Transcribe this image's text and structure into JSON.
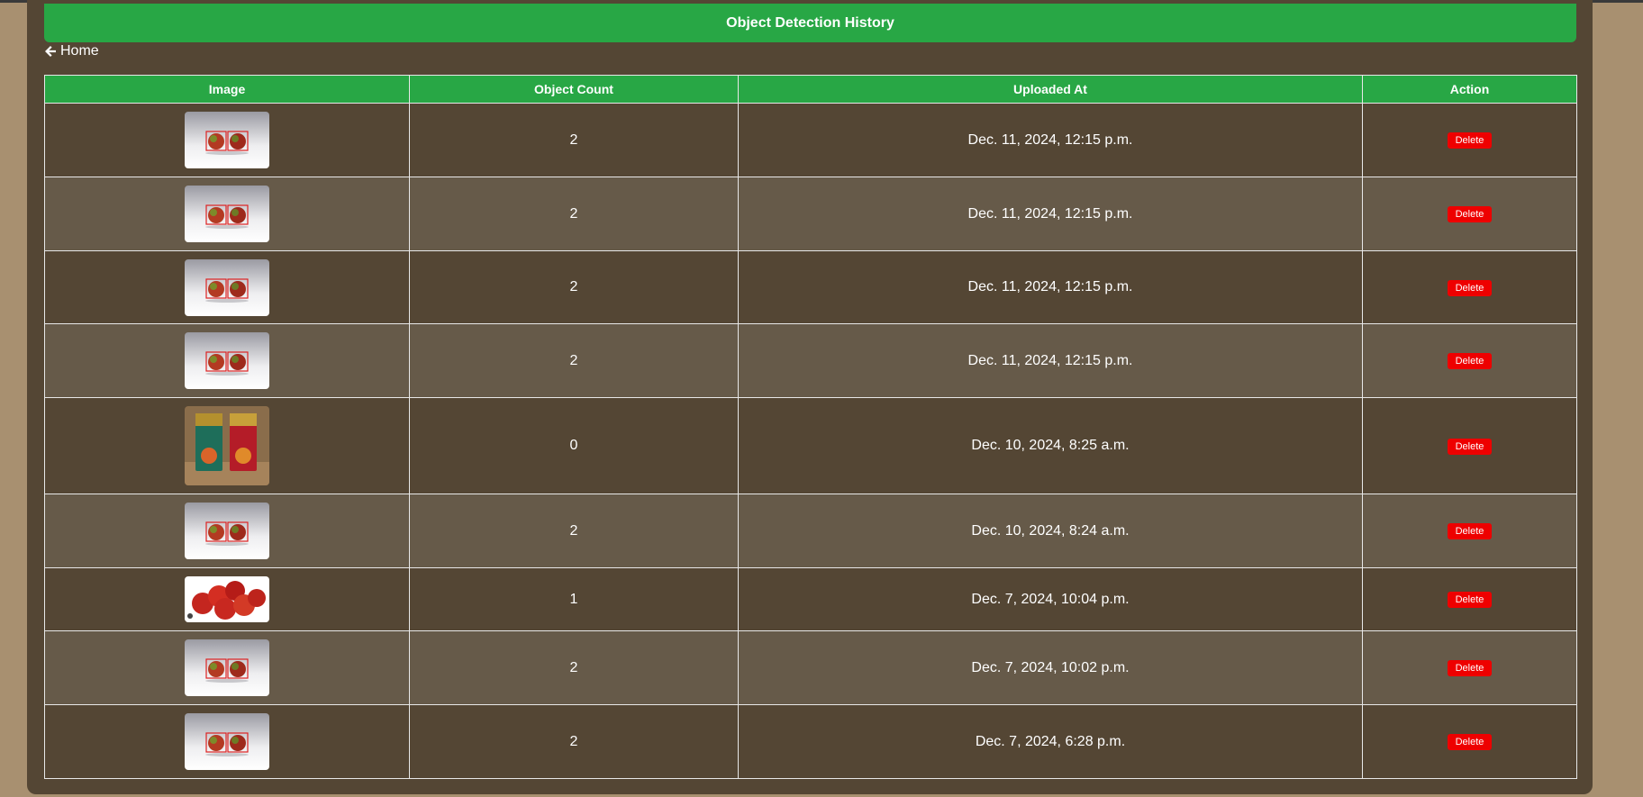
{
  "header": {
    "title": "Object Detection History"
  },
  "nav": {
    "home_label": "Home"
  },
  "table": {
    "columns": [
      "Image",
      "Object Count",
      "Uploaded At",
      "Action"
    ],
    "delete_label": "Delete",
    "rows": [
      {
        "thumbnail": "two-apples-boxes",
        "count": "2",
        "uploaded_at": "Dec. 11, 2024, 12:15 p.m."
      },
      {
        "thumbnail": "two-apples-boxes",
        "count": "2",
        "uploaded_at": "Dec. 11, 2024, 12:15 p.m."
      },
      {
        "thumbnail": "two-apples-boxes",
        "count": "2",
        "uploaded_at": "Dec. 11, 2024, 12:15 p.m."
      },
      {
        "thumbnail": "two-apples-boxes",
        "count": "2",
        "uploaded_at": "Dec. 11, 2024, 12:15 p.m."
      },
      {
        "thumbnail": "two-cans",
        "count": "0",
        "uploaded_at": "Dec. 10, 2024, 8:25 a.m."
      },
      {
        "thumbnail": "two-apples-boxes",
        "count": "2",
        "uploaded_at": "Dec. 10, 2024, 8:24 a.m."
      },
      {
        "thumbnail": "apple-pile",
        "count": "1",
        "uploaded_at": "Dec. 7, 2024, 10:04 p.m."
      },
      {
        "thumbnail": "two-apples-boxes",
        "count": "2",
        "uploaded_at": "Dec. 7, 2024, 10:02 p.m."
      },
      {
        "thumbnail": "two-apples-boxes",
        "count": "2",
        "uploaded_at": "Dec. 7, 2024, 6:28 p.m."
      }
    ]
  },
  "colors": {
    "accent": "#28a745",
    "panel": "#544634",
    "row_alt": "#665a49",
    "page_bg": "#a89070",
    "delete": "#ee0000"
  }
}
